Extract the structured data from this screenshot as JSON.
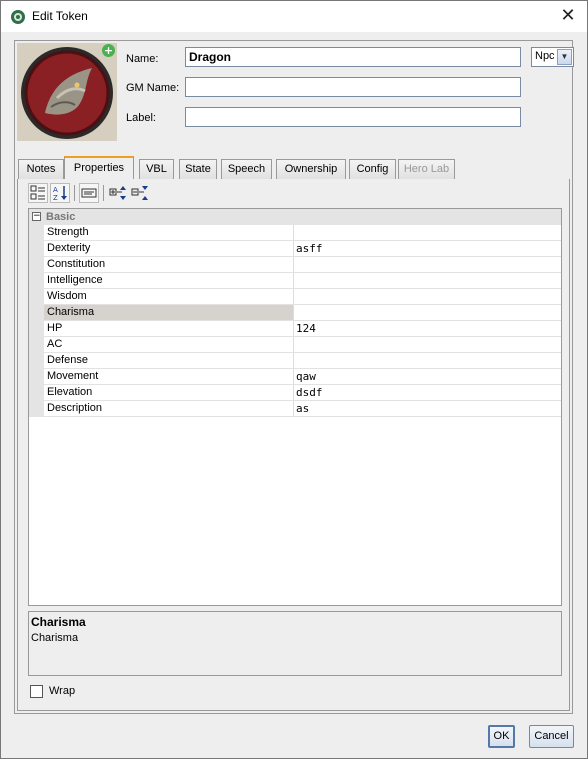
{
  "window": {
    "title": "Edit Token",
    "close_icon": "close-icon",
    "app_icon": "maptool-icon"
  },
  "header": {
    "name_label": "Name:",
    "name_value": "Dragon",
    "gm_name_label": "GM Name:",
    "gm_name_value": "",
    "label_label": "Label:",
    "label_value": "",
    "type_selected": "Npc",
    "portrait_add_icon": "plus-icon"
  },
  "tabs": [
    {
      "label": "Notes"
    },
    {
      "label": "Properties"
    },
    {
      "label": "VBL"
    },
    {
      "label": "State"
    },
    {
      "label": "Speech"
    },
    {
      "label": "Ownership"
    },
    {
      "label": "Config"
    },
    {
      "label": "Hero Lab"
    }
  ],
  "properties": {
    "category": "Basic",
    "category_toggle": "−",
    "rows": [
      {
        "key": "Strength",
        "value": ""
      },
      {
        "key": "Dexterity",
        "value": "asff"
      },
      {
        "key": "Constitution",
        "value": ""
      },
      {
        "key": "Intelligence",
        "value": ""
      },
      {
        "key": "Wisdom",
        "value": ""
      },
      {
        "key": "Charisma",
        "value": ""
      },
      {
        "key": "HP",
        "value": "124"
      },
      {
        "key": "AC",
        "value": ""
      },
      {
        "key": "Defense",
        "value": ""
      },
      {
        "key": "Movement",
        "value": "qaw"
      },
      {
        "key": "Elevation",
        "value": "dsdf"
      },
      {
        "key": "Description",
        "value": "as"
      }
    ],
    "selected_row": "Charisma"
  },
  "description_panel": {
    "title": "Charisma",
    "text": "Charisma"
  },
  "wrap_label": "Wrap",
  "buttons": {
    "ok": "OK",
    "cancel": "Cancel"
  }
}
